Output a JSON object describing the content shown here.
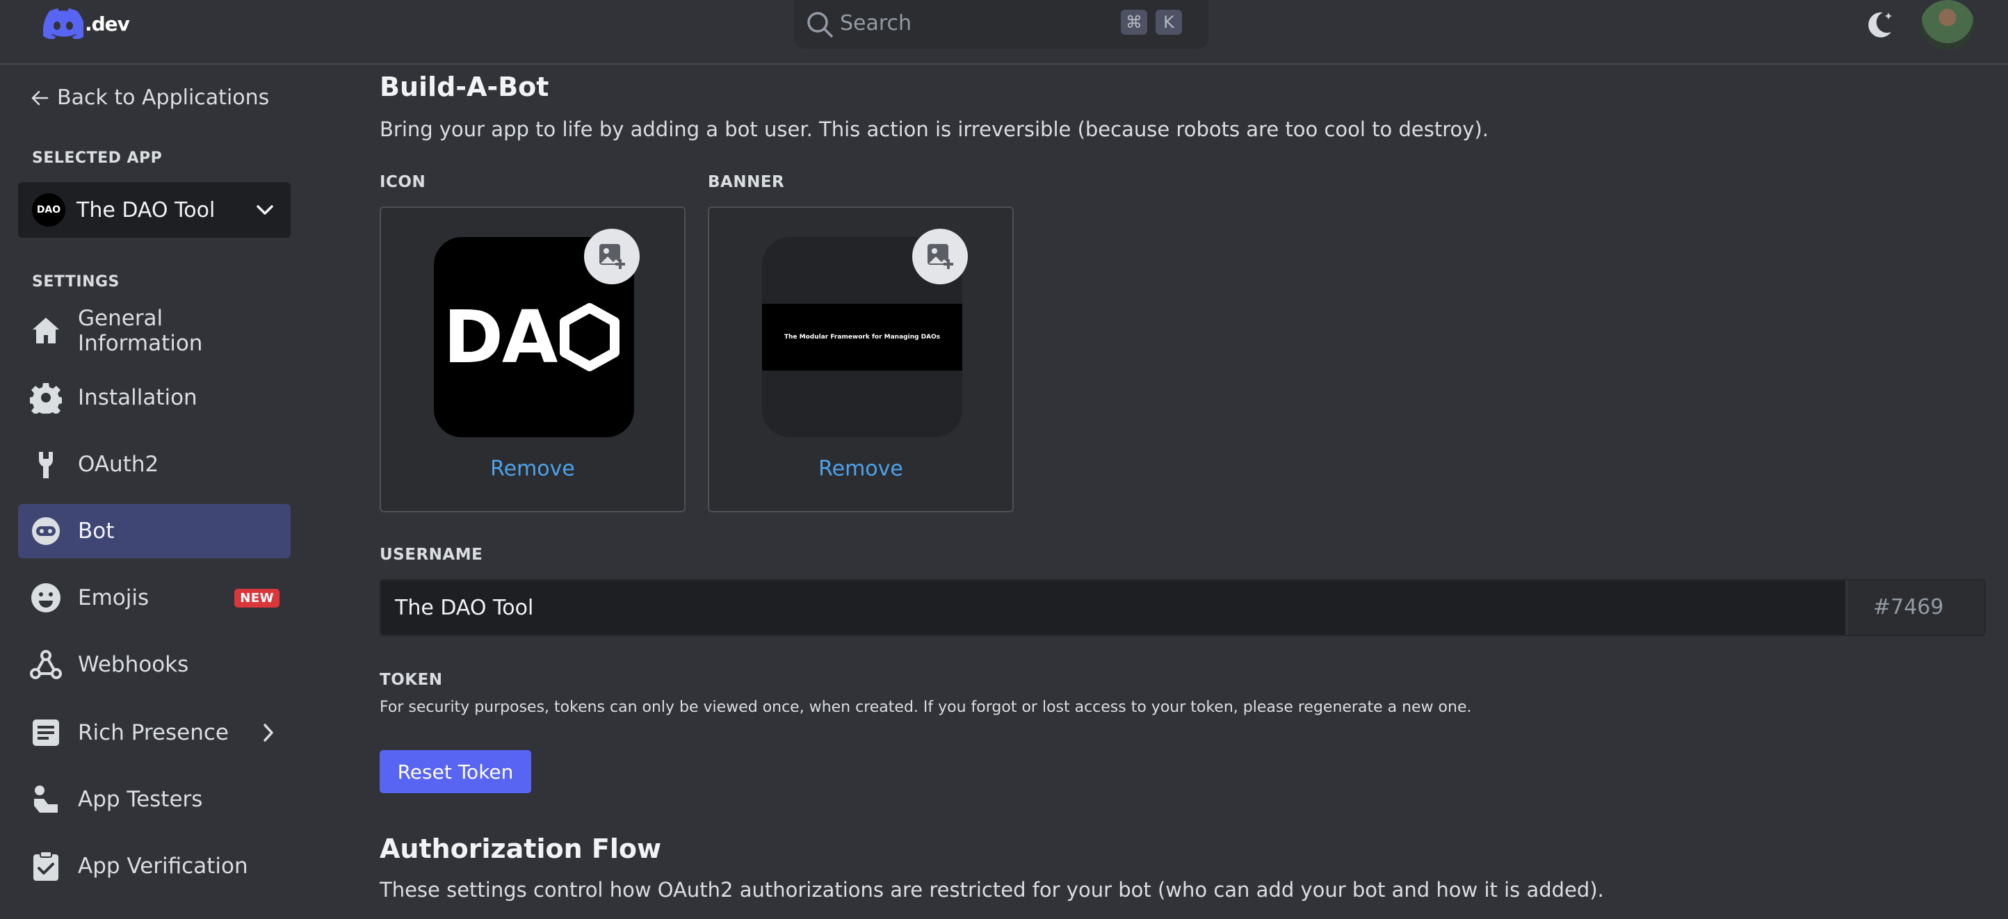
{
  "header": {
    "logo_text": ".dev",
    "search": {
      "placeholder": "Search",
      "shortcut_cmd": "⌘",
      "shortcut_key": "K"
    }
  },
  "sidebar": {
    "back_label": "Back to Applications",
    "selected_app_header": "SELECTED APP",
    "selected_app": {
      "name": "The DAO Tool",
      "avatar_text": "DAO"
    },
    "settings_header": "SETTINGS",
    "items": [
      {
        "label": "General Information",
        "icon": "home-icon",
        "active": false
      },
      {
        "label": "Installation",
        "icon": "gear-icon",
        "active": false
      },
      {
        "label": "OAuth2",
        "icon": "wrench-icon",
        "active": false
      },
      {
        "label": "Bot",
        "icon": "bot-icon",
        "active": true
      },
      {
        "label": "Emojis",
        "icon": "smiley-icon",
        "active": false,
        "badge": "NEW"
      },
      {
        "label": "Webhooks",
        "icon": "webhook-icon",
        "active": false
      },
      {
        "label": "Rich Presence",
        "icon": "document-icon",
        "active": false,
        "expandable": true
      },
      {
        "label": "App Testers",
        "icon": "tester-icon",
        "active": false
      },
      {
        "label": "App Verification",
        "icon": "clipboard-check-icon",
        "active": false
      }
    ]
  },
  "main": {
    "title": "Build-A-Bot",
    "subtitle": "Bring your app to life by adding a bot user. This action is irreversible (because robots are too cool to destroy).",
    "icon_label": "ICON",
    "banner_label": "BANNER",
    "icon_image_text": "DA",
    "banner_image_text": "The Modular Framework for Managing DAOs",
    "remove_label": "Remove",
    "username_label": "USERNAME",
    "username_value": "The DAO Tool",
    "discriminator": "#7469",
    "token_label": "TOKEN",
    "token_desc": "For security purposes, tokens can only be viewed once, when created. If you forgot or lost access to your token, please regenerate a new one.",
    "reset_token_label": "Reset Token",
    "auth_title": "Authorization Flow",
    "auth_desc": "These settings control how OAuth2 authorizations are restricted for your bot (who can add your bot and how it is added)."
  },
  "colors": {
    "background": "#313338",
    "sidebar_active": "#404674",
    "accent": "#5865f2",
    "link": "#4ea3ea",
    "badge_red": "#da373c"
  }
}
